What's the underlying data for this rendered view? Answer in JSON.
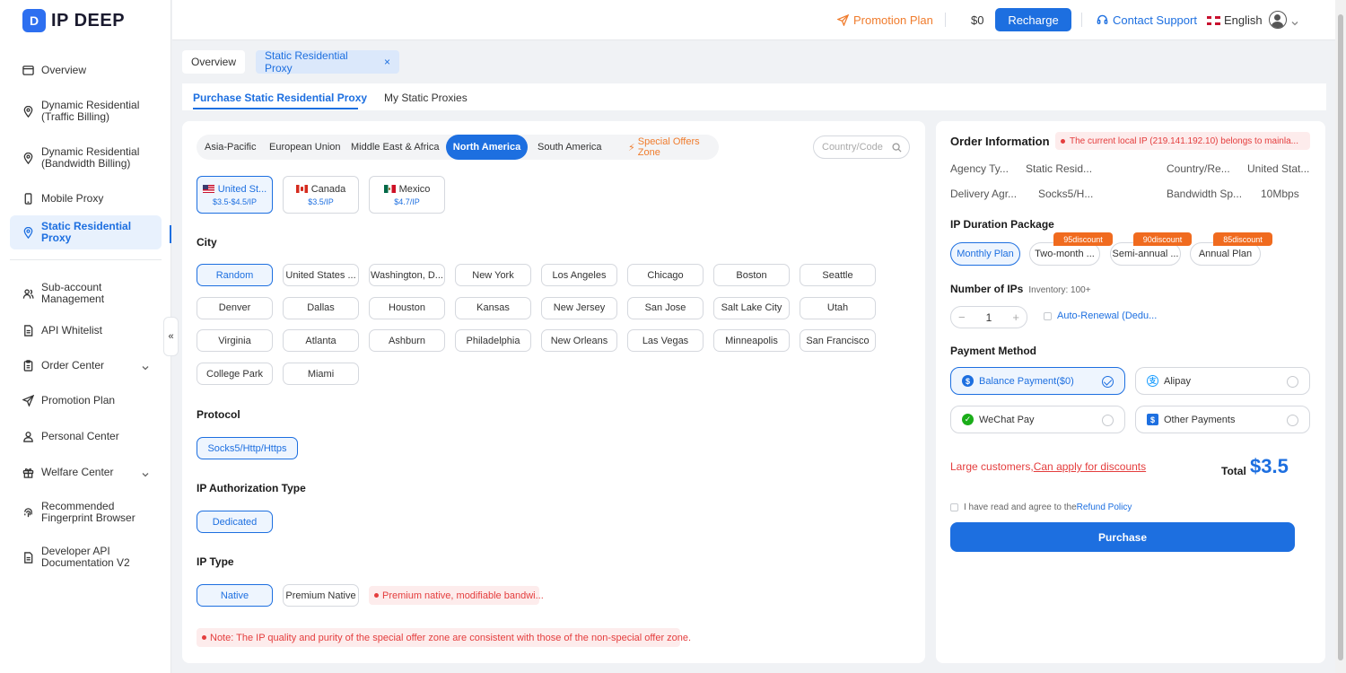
{
  "brand": {
    "name": "IP DEEP",
    "mark": "D"
  },
  "sidebar": {
    "items": [
      {
        "label": "Overview"
      },
      {
        "label": "Dynamic Residential\n(Traffic Billing)"
      },
      {
        "label": "Dynamic Residential\n(Bandwidth Billing)"
      },
      {
        "label": "Mobile Proxy"
      },
      {
        "label": "Static Residential Proxy"
      },
      {
        "label": "Sub-account\nManagement"
      },
      {
        "label": "API Whitelist"
      },
      {
        "label": "Order Center"
      },
      {
        "label": "Promotion Plan"
      },
      {
        "label": "Personal Center"
      },
      {
        "label": "Welfare Center"
      },
      {
        "label": "Recommended\nFingerprint Browser"
      },
      {
        "label": "Developer API\nDocumentation V2"
      }
    ],
    "collapse_glyph": "«"
  },
  "topbar": {
    "promotion": "Promotion Plan",
    "balance": "$0",
    "recharge": "Recharge",
    "support": "Contact Support",
    "language": "English"
  },
  "page_tabs": {
    "overview": "Overview",
    "static": "Static Residential Proxy",
    "close": "×"
  },
  "sub_tabs": {
    "purchase": "Purchase Static Residential Proxy",
    "my": "My Static Proxies"
  },
  "regions": [
    "Asia-Pacific",
    "European Union",
    "Middle East & Africa",
    "North America",
    "South America",
    "Special Offers Zone"
  ],
  "country_search_placeholder": "Country/Code",
  "countries": [
    {
      "name": "United St...",
      "price": "$3.5-$4.5/IP"
    },
    {
      "name": "Canada",
      "price": "$3.5/IP"
    },
    {
      "name": "Mexico",
      "price": "$4.7/IP"
    }
  ],
  "city": {
    "title": "City",
    "items": [
      "Random",
      "United States ...",
      "Washington, D...",
      "New York",
      "Los Angeles",
      "Chicago",
      "Boston",
      "Seattle",
      "Denver",
      "Dallas",
      "Houston",
      "Kansas",
      "New Jersey",
      "San Jose",
      "Salt Lake City",
      "Utah",
      "Virginia",
      "Atlanta",
      "Ashburn",
      "Philadelphia",
      "New Orleans",
      "Las Vegas",
      "Minneapolis",
      "San Francisco",
      "College Park",
      "Miami"
    ]
  },
  "protocol": {
    "title": "Protocol",
    "value": "Socks5/Http/Https"
  },
  "auth_type": {
    "title": "IP Authorization Type",
    "value": "Dedicated"
  },
  "ip_type": {
    "title": "IP Type",
    "options": [
      "Native",
      "Premium Native"
    ],
    "hint": "Premium native, modifiable bandwi..."
  },
  "note": "Note: The IP quality and purity of the special offer zone are consistent with those of the non-special offer zone.",
  "order": {
    "title": "Order Information",
    "warning": "The current local IP (219.141.192.10) belongs to mainla...",
    "info": [
      {
        "label": "Agency Ty...",
        "value": "Static Resid..."
      },
      {
        "label": "Country/Re...",
        "value": "United Stat..."
      },
      {
        "label": "Delivery Agr...",
        "value": "Socks5/H..."
      },
      {
        "label": "Bandwidth Sp...",
        "value": "10Mbps"
      }
    ],
    "duration": {
      "title": "IP Duration Package",
      "plans": [
        "Monthly Plan",
        "Two-month ...",
        "Semi-annual ...",
        "Annual Plan"
      ],
      "discounts": [
        "95discount",
        "90discount",
        "85discount"
      ]
    },
    "ips": {
      "title": "Number of IPs",
      "inventory": "Inventory: 100+",
      "value": "1",
      "minus": "−",
      "plus": "+",
      "auto_renewal": "Auto-Renewal (Dedu..."
    },
    "payment": {
      "title": "Payment Method",
      "methods": [
        "Balance Payment($0)",
        "Alipay",
        "WeChat Pay",
        "Other Payments"
      ]
    },
    "large_customers": "Large customers,",
    "apply_discount": "Can apply for discounts",
    "total_label": "Total",
    "total_value": "$3.5",
    "agree_text": "I have read and agree to the",
    "refund_policy": "Refund Policy",
    "purchase": "Purchase"
  }
}
